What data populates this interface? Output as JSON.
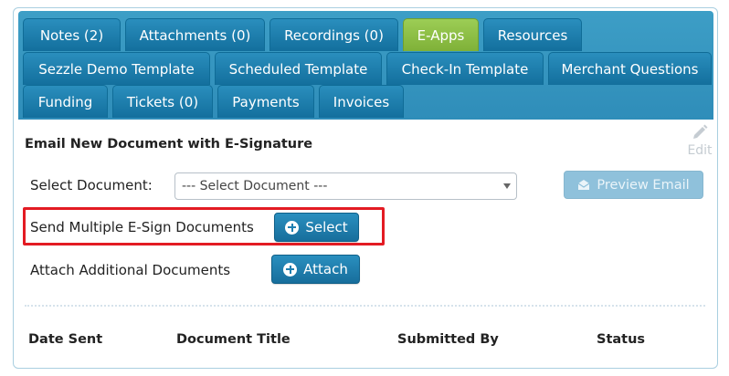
{
  "tabs": {
    "row1": [
      "Notes (2)",
      "Attachments (0)",
      "Recordings (0)",
      "E-Apps",
      "Resources"
    ],
    "row2": [
      "Sezzle Demo Template",
      "Scheduled Template",
      "Check-In Template",
      "Merchant Questions"
    ],
    "row3": [
      "Funding",
      "Tickets (0)",
      "Payments",
      "Invoices"
    ],
    "active": "E-Apps"
  },
  "section": {
    "title": "Email New Document with E-Signature",
    "edit_label": "Edit",
    "select_document_label": "Select Document:",
    "select_document_value": "--- Select Document ---",
    "preview_email_label": "Preview Email",
    "multi_esign_label": "Send Multiple E-Sign Documents",
    "select_button_label": "Select",
    "attach_additional_label": "Attach Additional Documents",
    "attach_button_label": "Attach"
  },
  "table": {
    "headers": [
      "Date Sent",
      "Document Title",
      "Submitted By",
      "Status"
    ]
  },
  "colors": {
    "tab_blue": "#1f82b3",
    "tab_active_green": "#8dc046",
    "highlight_red": "#e31b23",
    "preview_disabled": "#8fc1db"
  }
}
